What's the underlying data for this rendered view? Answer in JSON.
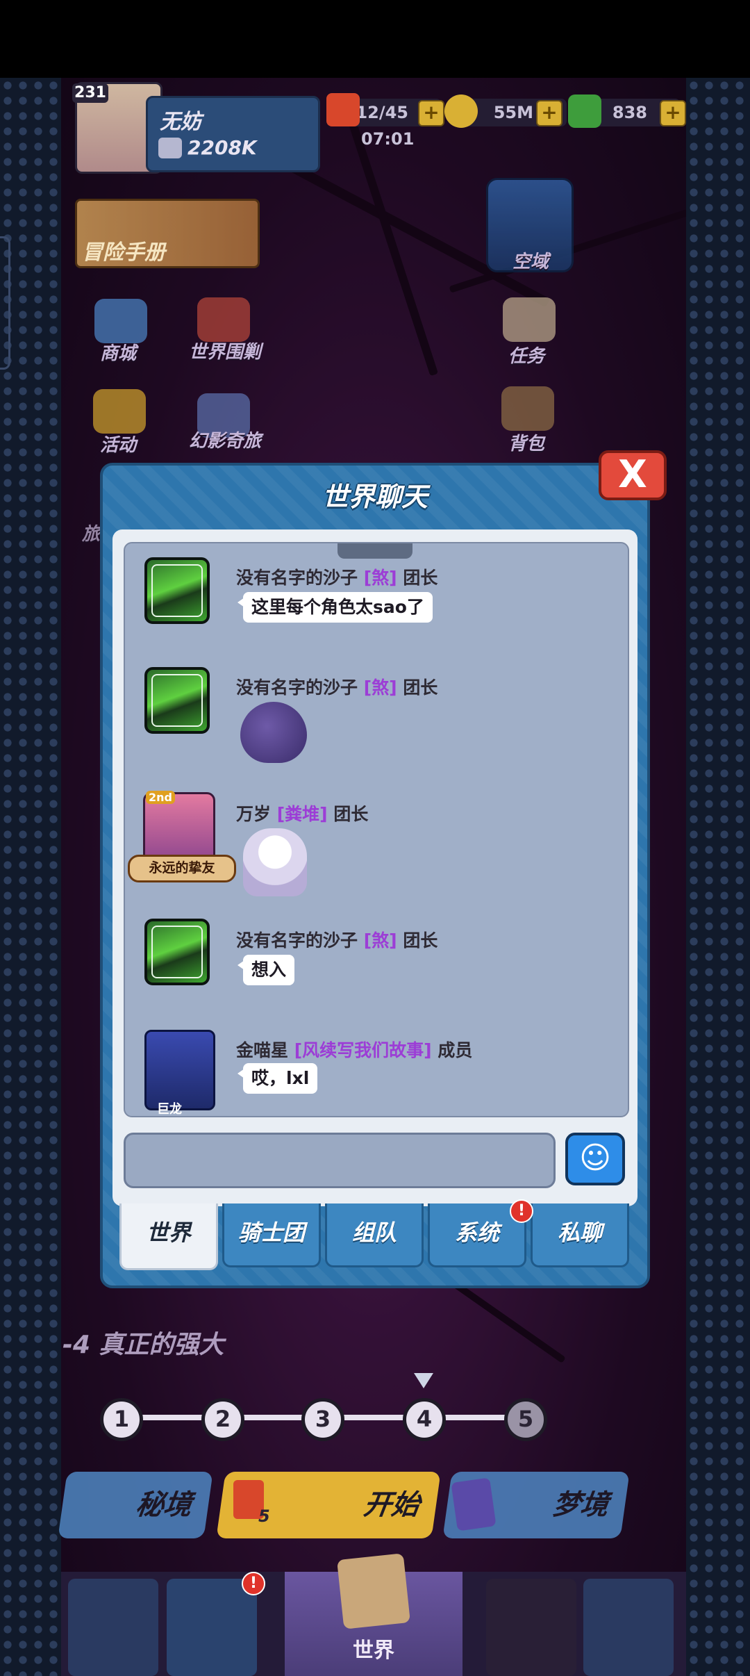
{
  "hud": {
    "level": "231",
    "player_name": "无妨",
    "power": "2208K",
    "stamina": "12/45",
    "stamina_timer": "07:01",
    "gold": "55M",
    "gems": "838"
  },
  "menu": {
    "adventure_manual": "冒险手册",
    "airspace": "空域",
    "shop": "商城",
    "world_siege": "世界围剿",
    "quests": "任务",
    "events": "活动",
    "phantom_journey": "幻影奇旅",
    "backpack": "背包",
    "side_partial": "旅"
  },
  "dialog": {
    "title": "世界聊天",
    "close_label": "X",
    "messages": [
      {
        "name": "没有名字的沙子",
        "guild": "[煞]",
        "role": "团长",
        "text": "这里每个角色太sao了",
        "type": "text"
      },
      {
        "name": "没有名字的沙子",
        "guild": "[煞]",
        "role": "团长",
        "type": "sticker",
        "sticker": "crying-monster"
      },
      {
        "name": "万岁",
        "guild": "[粪堆]",
        "role": "团长",
        "type": "sticker",
        "sticker": "anime-girl",
        "frame_label": "永远的挚友",
        "badge": "2nd"
      },
      {
        "name": "没有名字的沙子",
        "guild": "[煞]",
        "role": "团长",
        "text": "想入",
        "type": "text"
      },
      {
        "name": "金喵星",
        "guild": "[风续写我们故事]",
        "role": "成员",
        "text": "哎，lxl",
        "type": "text",
        "avatar_label": "巨龙"
      }
    ],
    "input_placeholder": "",
    "emoji_icon": "smiley-icon",
    "tabs": [
      {
        "label": "世界",
        "active": true
      },
      {
        "label": "骑士团",
        "active": false
      },
      {
        "label": "组队",
        "active": false
      },
      {
        "label": "系统",
        "active": false,
        "badge": "!"
      },
      {
        "label": "私聊",
        "active": false
      }
    ]
  },
  "stage": {
    "title": "-4 真正的强大",
    "steps": [
      "1",
      "2",
      "3",
      "4",
      "5"
    ],
    "current_step": "4"
  },
  "actions": {
    "secret_realm": "秘境",
    "start": "开始",
    "start_cost": "5",
    "dream_realm": "梦境"
  },
  "bottom_nav": {
    "world_label": "世界",
    "badge": "!"
  },
  "colors": {
    "guild_name": "#9c3dd6",
    "dialog_blue": "#2e76ad",
    "close_red": "#e34a3c",
    "chat_bg": "#a0afc8"
  }
}
